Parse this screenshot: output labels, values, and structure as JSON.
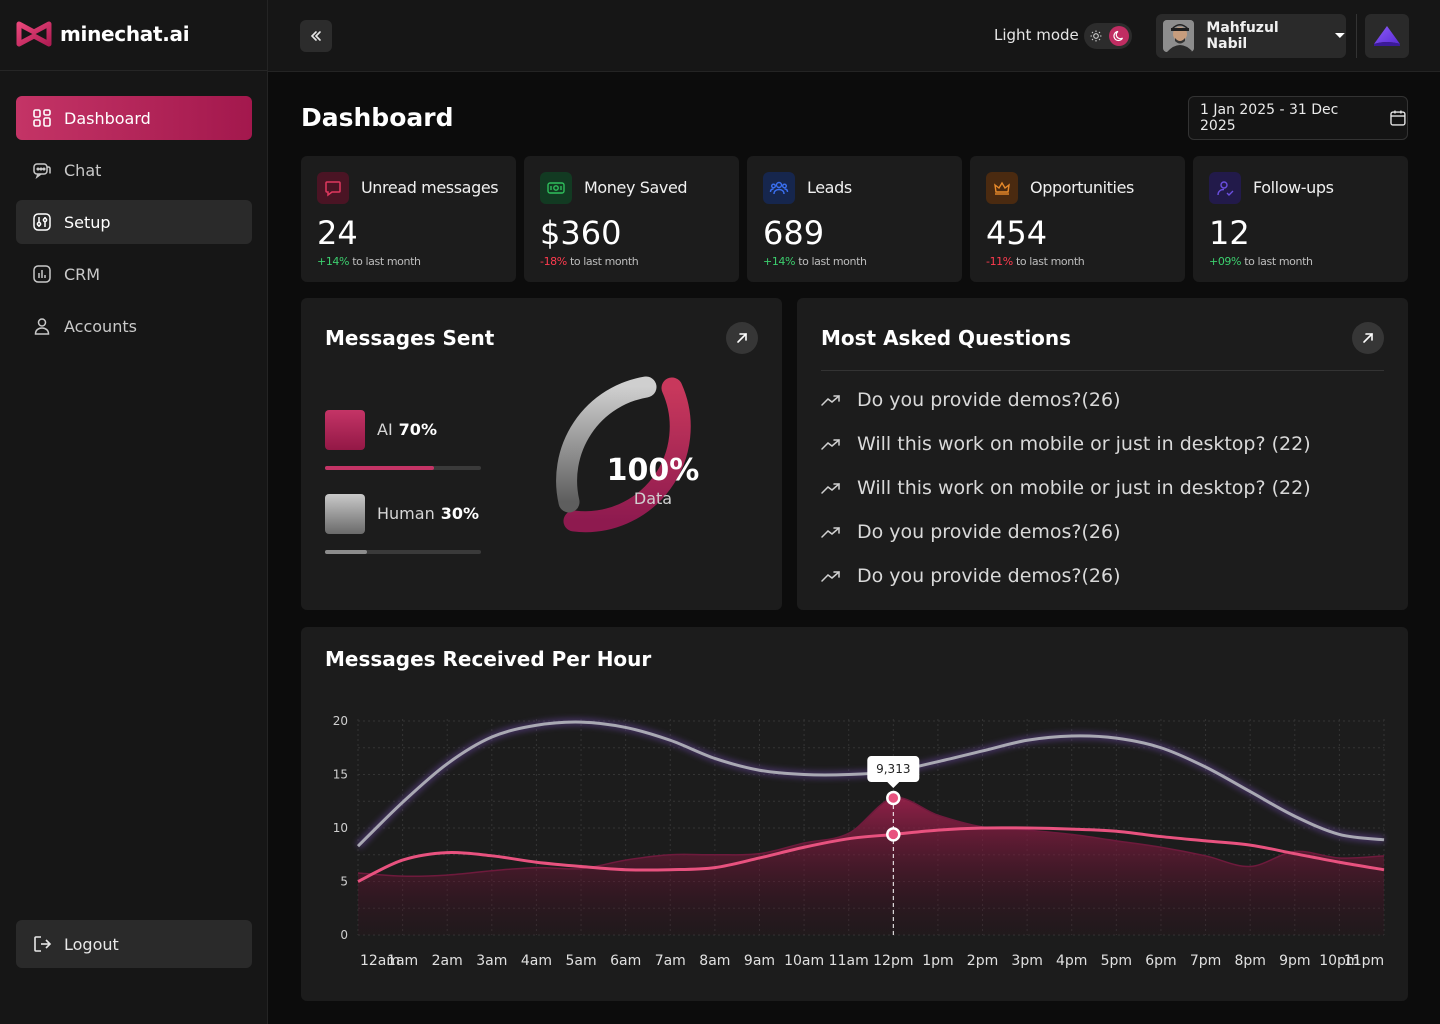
{
  "brand": {
    "name": "minechat.ai",
    "accent": "#c43466"
  },
  "sidebar": {
    "items": [
      {
        "label": "Dashboard",
        "icon": "grid-icon"
      },
      {
        "label": "Chat",
        "icon": "chat-icon"
      },
      {
        "label": "Setup",
        "icon": "sliders-icon"
      },
      {
        "label": "CRM",
        "icon": "chart-icon"
      },
      {
        "label": "Accounts",
        "icon": "user-icon"
      }
    ],
    "logout": "Logout"
  },
  "topbar": {
    "mode_label": "Light mode",
    "user_name": "Mahfuzul Nabil"
  },
  "page": {
    "title": "Dashboard",
    "date_range": "1 Jan 2025 - 31 Dec 2025"
  },
  "stats": [
    {
      "label": "Unread messages",
      "value": "24",
      "change": "+14%",
      "suffix": "to last month",
      "trend": "up",
      "icon": "message-icon",
      "color": "#e0385f"
    },
    {
      "label": "Money Saved",
      "value": "$360",
      "change": "-18%",
      "suffix": "to last month",
      "trend": "down",
      "icon": "money-icon",
      "color": "#2fbf5c"
    },
    {
      "label": "Leads",
      "value": "689",
      "change": "+14%",
      "suffix": "to last month",
      "trend": "up",
      "icon": "users-icon",
      "color": "#3a6ff0"
    },
    {
      "label": "Opportunities",
      "value": "454",
      "change": "-11%",
      "suffix": "to last month",
      "trend": "down",
      "icon": "crown-icon",
      "color": "#e88a2a"
    },
    {
      "label": "Follow-ups",
      "value": "12",
      "change": "+09%",
      "suffix": "to last month",
      "trend": "up",
      "icon": "user-check-icon",
      "color": "#6b4fe0"
    }
  ],
  "messages_sent": {
    "title": "Messages Sent",
    "legend": [
      {
        "label": "AI",
        "pct": "70%",
        "fraction": 0.7
      },
      {
        "label": "Human",
        "pct": "30%",
        "fraction": 0.27
      }
    ],
    "center_value": "100%",
    "center_label": "Data"
  },
  "questions": {
    "title": "Most Asked Questions",
    "items": [
      "Do you provide demos?(26)",
      "Will this work on mobile or just in desktop? (22)",
      "Will this work on mobile or just in desktop? (22)",
      "Do you provide demos?(26)",
      "Do you provide demos?(26)"
    ]
  },
  "chart_data": {
    "type": "area",
    "title": "Messages Received Per Hour",
    "categories": [
      "12am",
      "1am",
      "2am",
      "3am",
      "4am",
      "5am",
      "6am",
      "7am",
      "8am",
      "9am",
      "10am",
      "11am",
      "12pm",
      "1pm",
      "2pm",
      "3pm",
      "4pm",
      "5pm",
      "6pm",
      "7pm",
      "8pm",
      "9pm",
      "10pm",
      "11pm"
    ],
    "y_ticks": [
      "20",
      "15",
      "10",
      "5",
      "0"
    ],
    "ylim": [
      0,
      20
    ],
    "grid": true,
    "tooltip": {
      "category": "12pm",
      "label": "9,313"
    },
    "series": [
      {
        "color": "#a9a9b3",
        "values": [
          8.3,
          12.4,
          16.0,
          18.5,
          19.6,
          19.9,
          19.4,
          18.2,
          16.5,
          15.4,
          15.0,
          15.0,
          15.3,
          16.2,
          17.2,
          18.2,
          18.6,
          18.4,
          17.5,
          15.7,
          13.4,
          11.1,
          9.4,
          8.9
        ]
      },
      {
        "color": "#e8527f",
        "values": [
          5.0,
          7.0,
          7.7,
          7.4,
          6.8,
          6.4,
          6.1,
          6.1,
          6.3,
          7.2,
          8.2,
          9.0,
          9.4,
          9.8,
          10.0,
          10.0,
          9.9,
          9.7,
          9.2,
          8.8,
          8.4,
          7.6,
          6.8,
          6.1
        ]
      },
      {
        "color": "#6e1a3c",
        "values": [
          5.8,
          5.5,
          5.6,
          6.0,
          6.3,
          6.2,
          7.0,
          7.5,
          7.5,
          7.6,
          8.6,
          9.5,
          12.8,
          11.2,
          10.1,
          9.8,
          9.4,
          8.8,
          8.2,
          7.4,
          6.4,
          7.8,
          7.2,
          7.4
        ]
      }
    ]
  }
}
